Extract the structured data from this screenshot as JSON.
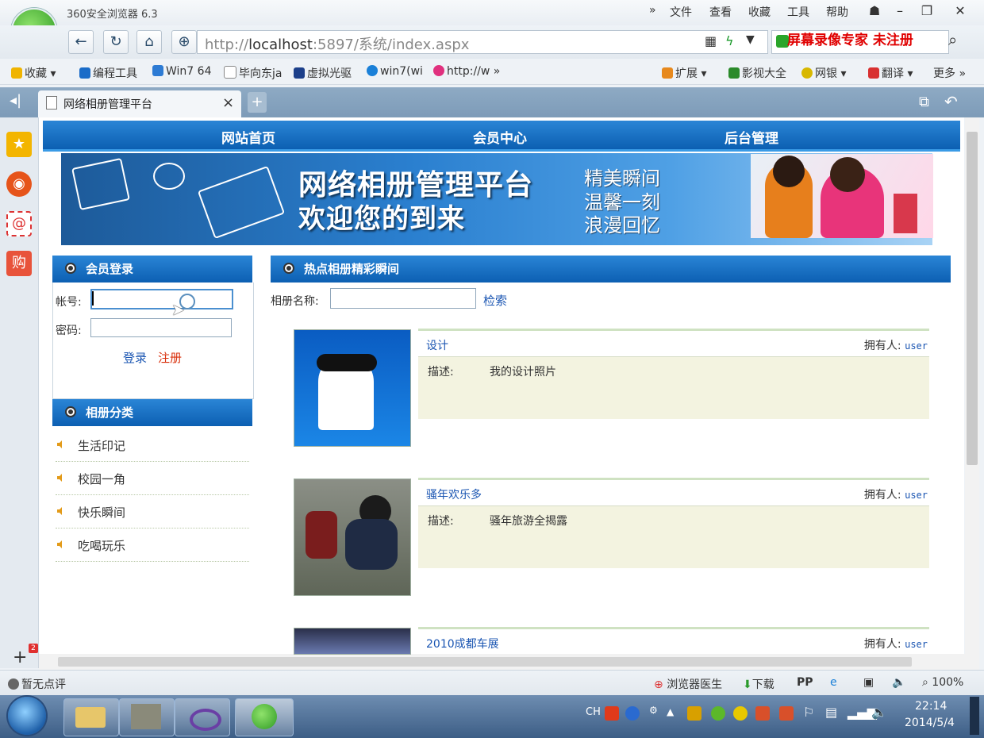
{
  "browser": {
    "app_title": "360安全浏览器 6.3",
    "menu": [
      "文件",
      "查看",
      "收藏",
      "工具",
      "帮助"
    ],
    "address_prefix": "http://",
    "address_host": "localhost",
    "address_rest": ":5897/系统/index.aspx",
    "watermark": "屏幕录像专家  未注册",
    "bookmarks": [
      "收藏",
      "编程工具",
      "Win7 64",
      "毕向东ja",
      "虚拟光驱",
      "win7(wi",
      "http://w"
    ],
    "bookmarks_right": [
      "扩展",
      "影视大全",
      "网银",
      "翻译",
      "更多"
    ],
    "tab_title": "网络相册管理平台",
    "status_left": "暂无点评",
    "status_right": [
      "浏览器医生",
      "下载"
    ],
    "zoom": "100%"
  },
  "site": {
    "nav": [
      "网站首页",
      "会员中心",
      "后台管理"
    ],
    "banner_title1": "网络相册管理平台",
    "banner_title2": "欢迎您的到来",
    "slogans": [
      "精美瞬间",
      "温馨一刻",
      "浪漫回忆"
    ]
  },
  "login": {
    "title": "会员登录",
    "account_label": "帐号:",
    "password_label": "密码:",
    "login_link": "登录",
    "register_link": "注册"
  },
  "categories": {
    "title": "相册分类",
    "items": [
      "生活印记",
      "校园一角",
      "快乐瞬间",
      "吃喝玩乐"
    ]
  },
  "hot": {
    "title": "热点相册精彩瞬间",
    "search_label": "相册名称:",
    "search_button": "检索",
    "owner_label": "拥有人:",
    "desc_label": "描述:",
    "albums": [
      {
        "title": "设计",
        "owner": "user",
        "desc": "我的设计照片"
      },
      {
        "title": "骚年欢乐多",
        "owner": "user",
        "desc": "骚年旅游全揭露"
      },
      {
        "title": "2010成都车展",
        "owner": "user",
        "desc": ""
      }
    ]
  },
  "taskbar": {
    "time": "22:14",
    "date": "2014/5/4",
    "lang": "CH"
  },
  "rail_badge": "2",
  "colors": {
    "site_blue": "#0c5fb2",
    "link_blue": "#1a55b2",
    "link_red": "#d9300c",
    "watermark_red": "#e00000"
  }
}
